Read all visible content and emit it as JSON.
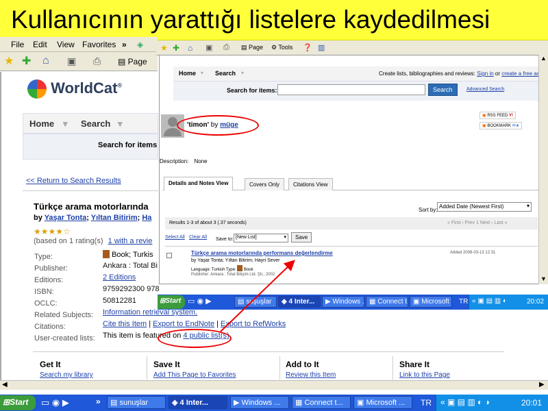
{
  "slide_title": "Kullanıcının yarattığı listelere kaydedilmesi",
  "menu": {
    "file": "File",
    "edit": "Edit",
    "view": "View",
    "favorites": "Favorites",
    "more": "»"
  },
  "back_toolbar": {
    "page": "Page"
  },
  "front_toolbar": {
    "page": "Page",
    "tools": "Tools"
  },
  "back": {
    "logo_text": "WorldCat",
    "nav_home": "Home",
    "nav_search": "Search",
    "search_for_items": "Search for items",
    "return_link": "<< Return to Search Results",
    "item_title": "Türkçe arama motorlarında",
    "by_label": "by",
    "author1": "Yaşar Tonta",
    "author2": "Yıltan Bitirim",
    "author3_partial": "Ha",
    "stars": "★★★★☆",
    "rating_text": "(based on 1 rating(s)",
    "review_link": "1 with a revie",
    "rows": [
      {
        "label": "Type:",
        "value": "Book; Turkis"
      },
      {
        "label": "Publisher:",
        "value": "Ankara : Total Bi"
      },
      {
        "label": "Editions:",
        "value": "2 Editions"
      },
      {
        "label": "ISBN:",
        "value": "9759292300 978"
      },
      {
        "label": "OCLC:",
        "value": "50812281"
      },
      {
        "label": "Related Subjects:",
        "value": "Information retrieval system."
      },
      {
        "label": "Citations:",
        "value": "Cite this Item"
      },
      {
        "label": "User-created lists:",
        "value": "This item is featured on"
      }
    ],
    "export_endnote": "Export to EndNote",
    "export_refworks": "Export to RefWorks",
    "sep": "|",
    "public_lists": "4 public list(s)",
    "bottom": [
      {
        "head": "Get It",
        "link": "Search my library"
      },
      {
        "head": "Save It",
        "link": "Add This Page to Favorites"
      },
      {
        "head": "Add to It",
        "link": "Review this Item"
      },
      {
        "head": "Share It",
        "link": "Link to this Page"
      }
    ]
  },
  "front": {
    "nav_home": "Home",
    "nav_search": "Search",
    "create_text": "Create lists, bibliographies and reviews:",
    "sign_in": "Sign in",
    "or": "or",
    "create_free": "create a free acc",
    "search_for_items": "Search for items:",
    "search_btn": "Search",
    "advanced": "Advanced Search",
    "list_name": "'timon'",
    "by": "by",
    "user": "müge",
    "rss": "RSS FEED",
    "bookmark": "BOOKMARK",
    "description_label": "Description:",
    "description_value": "None",
    "tabs": [
      "Details and Notes View",
      "Covers Only",
      "Citations View"
    ],
    "sort_label": "Sort by:",
    "sort_value": "Added Date (Newest First)",
    "results": "Results 1-3 of about 3 (.37 seconds)",
    "pager": "« First ‹ Prev 1 Next › Last »",
    "select_all": "Select All",
    "clear_all": "Clear All",
    "save_to": "Save to:",
    "save_list": "[New List]",
    "save_btn": "Save",
    "result_title": "Türkçe arama motorlarında performans değerlendirme",
    "result_authors": "by Yaşar Tonta; Yıltan Bitirim; Hayri Sever",
    "result_lang": "Language: Turkish  Type:",
    "result_type": "Book",
    "result_pub": "Publisher: Ankara : Total Bilişim Ltd. Şti., 2002",
    "added": "Added 2008-03-13 12:31"
  },
  "taskbar_front": {
    "start": "Start",
    "items": [
      "suşuşlar",
      "4 Inter...",
      "Windows ...",
      "Connect t...",
      "Microsoft ..."
    ],
    "lang": "TR",
    "time": "20:02"
  },
  "taskbar_back": {
    "start": "Start",
    "items": [
      "sunuşlar",
      "4 Inter...",
      "Windows ...",
      "Connect t...",
      "Microsoft ..."
    ],
    "lang": "TR",
    "time": "20:01"
  }
}
